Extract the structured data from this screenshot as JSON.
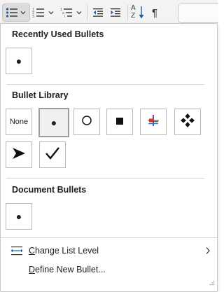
{
  "ribbon": {
    "bullets_icon": "bullets-list-icon",
    "numbering_icon": "numbering-list-icon",
    "multilevel_icon": "multilevel-list-icon",
    "decrease_indent_icon": "decrease-indent-icon",
    "increase_indent_icon": "increase-indent-icon",
    "sort_icon": "sort-az-icon",
    "pilcrow_icon": "show-formatting-icon",
    "sort_letters": [
      "A",
      "Z"
    ],
    "pilcrow": "¶"
  },
  "panel": {
    "recently_used": {
      "title": "Recently Used Bullets",
      "items": [
        {
          "symbol": "filled-circle",
          "glyph": "●"
        }
      ]
    },
    "library": {
      "title": "Bullet Library",
      "items": [
        {
          "symbol": "none",
          "label": "None"
        },
        {
          "symbol": "filled-circle",
          "glyph": "●",
          "selected": true
        },
        {
          "symbol": "hollow-circle",
          "glyph": "○"
        },
        {
          "symbol": "filled-square",
          "glyph": "■"
        },
        {
          "symbol": "colored-star-arrows"
        },
        {
          "symbol": "four-diamonds",
          "glyph": "❖"
        },
        {
          "symbol": "arrowhead",
          "glyph": "➤"
        },
        {
          "symbol": "checkmark",
          "glyph": "✓"
        }
      ]
    },
    "document": {
      "title": "Document Bullets",
      "items": [
        {
          "symbol": "filled-circle",
          "glyph": "●"
        }
      ]
    },
    "menu": {
      "change_level": {
        "label_first": "C",
        "label_rest": "hange List Level",
        "icon": "change-list-level-icon",
        "submenu_icon": "chevron-right-icon"
      },
      "define_new": {
        "label_first": "D",
        "label_rest": "efine New Bullet..."
      }
    }
  },
  "colors": {
    "accent_blue": "#1e5ea8",
    "tile_border": "#b8b8b8",
    "selected_tile_bg": "#f0f0f0"
  }
}
